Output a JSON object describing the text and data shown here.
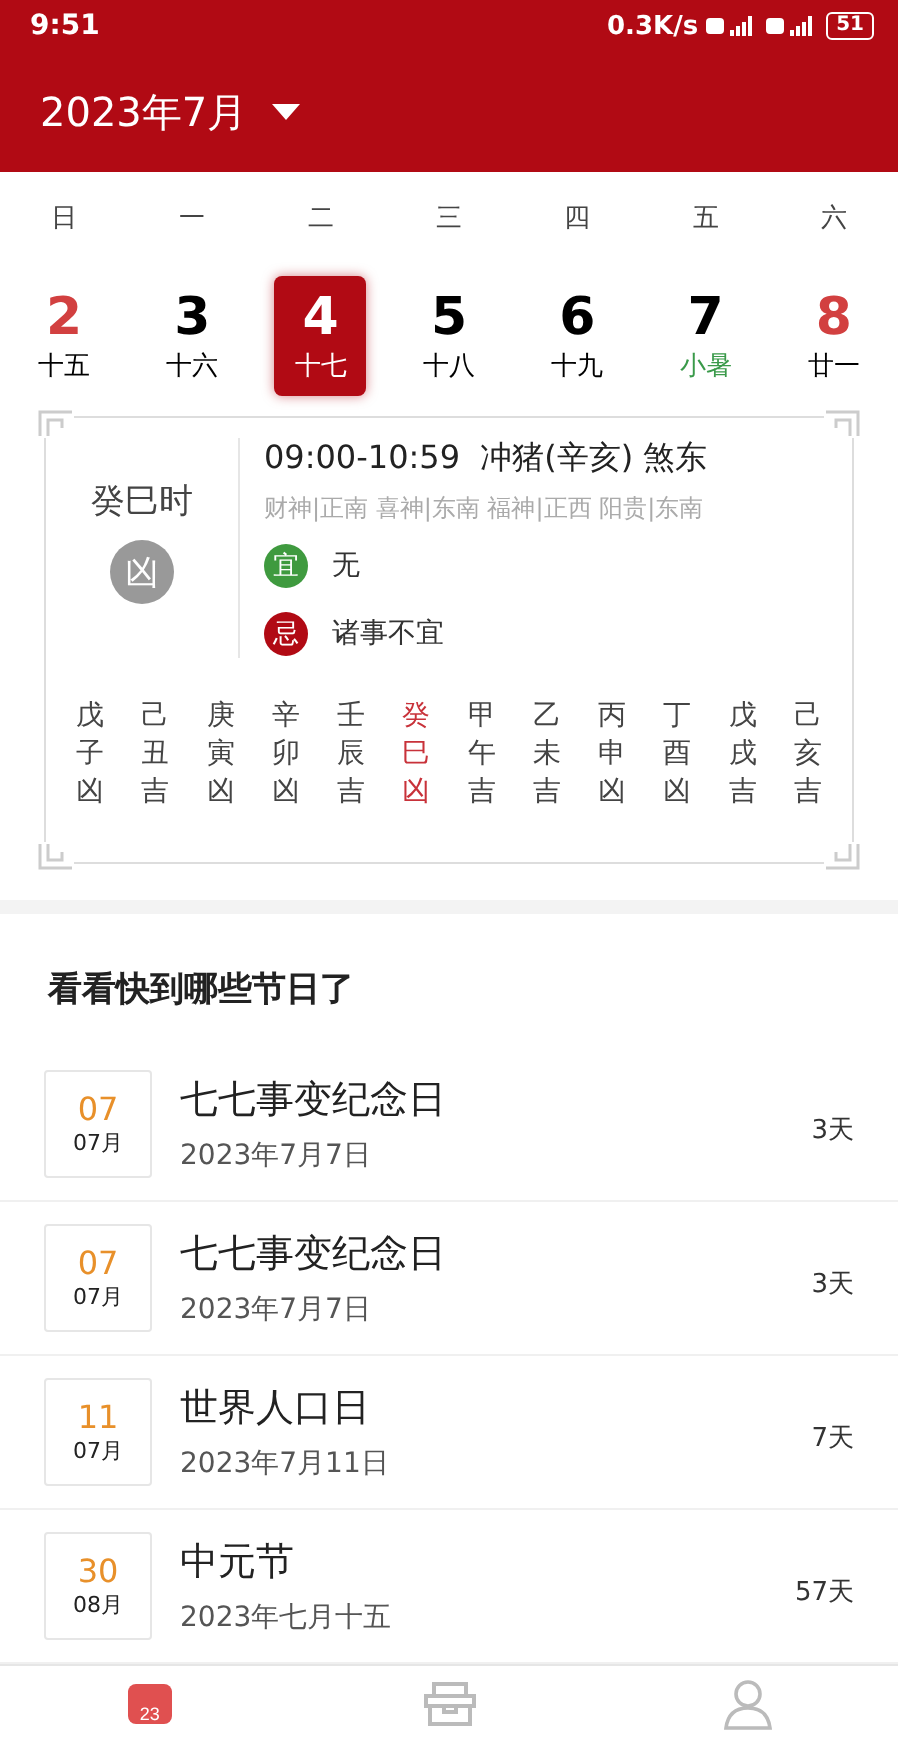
{
  "status_bar": {
    "time": "9:51",
    "speed": "0.3K/s",
    "battery": "51"
  },
  "header": {
    "title": "2023年7月"
  },
  "weekdays": [
    "日",
    "一",
    "二",
    "三",
    "四",
    "五",
    "六"
  ],
  "days": [
    {
      "number": "2",
      "lunar": "十五",
      "selected": false,
      "weekend": true,
      "term": false
    },
    {
      "number": "3",
      "lunar": "十六",
      "selected": false,
      "weekend": false,
      "term": false
    },
    {
      "number": "4",
      "lunar": "十七",
      "selected": true,
      "weekend": false,
      "term": false
    },
    {
      "number": "5",
      "lunar": "十八",
      "selected": false,
      "weekend": false,
      "term": false
    },
    {
      "number": "6",
      "lunar": "十九",
      "selected": false,
      "weekend": false,
      "term": false
    },
    {
      "number": "7",
      "lunar": "小暑",
      "selected": false,
      "weekend": false,
      "term": true
    },
    {
      "number": "8",
      "lunar": "廿一",
      "selected": false,
      "weekend": true,
      "term": false
    }
  ],
  "hour_card": {
    "name": "癸巳时",
    "luck": "凶",
    "time": "09:00-10:59  冲猪(辛亥) 煞东",
    "gods": "财神|正南 喜神|东南 福神|正西 阳贵|东南",
    "rows": [
      {
        "kind": "good",
        "tag": "宜",
        "text": "无"
      },
      {
        "kind": "bad",
        "tag": "忌",
        "text": "诸事不宜"
      }
    ],
    "hours": [
      {
        "stem": "戊",
        "branch": "子",
        "luck": "凶",
        "current": false
      },
      {
        "stem": "己",
        "branch": "丑",
        "luck": "吉",
        "current": false
      },
      {
        "stem": "庚",
        "branch": "寅",
        "luck": "凶",
        "current": false
      },
      {
        "stem": "辛",
        "branch": "卯",
        "luck": "凶",
        "current": false
      },
      {
        "stem": "壬",
        "branch": "辰",
        "luck": "吉",
        "current": false
      },
      {
        "stem": "癸",
        "branch": "巳",
        "luck": "凶",
        "current": true
      },
      {
        "stem": "甲",
        "branch": "午",
        "luck": "吉",
        "current": false
      },
      {
        "stem": "乙",
        "branch": "未",
        "luck": "吉",
        "current": false
      },
      {
        "stem": "丙",
        "branch": "申",
        "luck": "凶",
        "current": false
      },
      {
        "stem": "丁",
        "branch": "酉",
        "luck": "凶",
        "current": false
      },
      {
        "stem": "戊",
        "branch": "戌",
        "luck": "吉",
        "current": false
      },
      {
        "stem": "己",
        "branch": "亥",
        "luck": "吉",
        "current": false
      }
    ]
  },
  "festivals": {
    "heading": "看看快到哪些节日了",
    "items": [
      {
        "day": "07",
        "month": "07月",
        "name": "七七事变纪念日",
        "date": "2023年7月7日",
        "countdown": "3天"
      },
      {
        "day": "07",
        "month": "07月",
        "name": "七七事变纪念日",
        "date": "2023年7月7日",
        "countdown": "3天"
      },
      {
        "day": "11",
        "month": "07月",
        "name": "世界人口日",
        "date": "2023年7月11日",
        "countdown": "7天"
      },
      {
        "day": "30",
        "month": "08月",
        "name": "中元节",
        "date": "2023年七月十五",
        "countdown": "57天"
      }
    ]
  },
  "tabs": [
    {
      "kind": "calendar",
      "icon_text": "23",
      "selected": true
    },
    {
      "kind": "box",
      "selected": false
    },
    {
      "kind": "person",
      "selected": false
    }
  ]
}
